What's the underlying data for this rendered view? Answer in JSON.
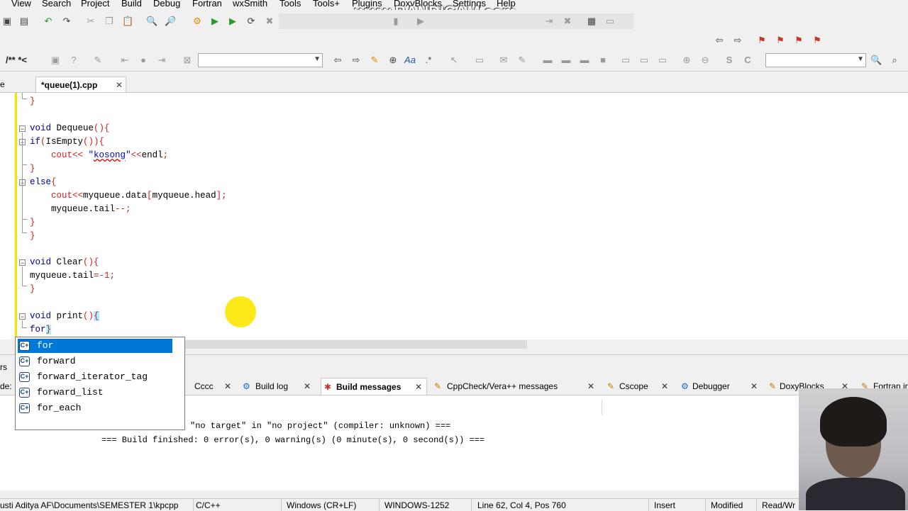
{
  "watermark": "www.BANDICAM.com",
  "menu": [
    "View",
    "Search",
    "Project",
    "Build",
    "Debug",
    "Fortran",
    "wxSmith",
    "Tools",
    "Tools+",
    "Plugins",
    "DoxyBlocks",
    "Settings",
    "Help"
  ],
  "toolbar2": {
    "doc_comment_label": "/** *<"
  },
  "editor_tabs": {
    "left_partial": "e",
    "active": "*queue(1).cpp"
  },
  "code": [
    "}",
    "",
    "void Dequeue(){",
    "if(IsEmpty()){",
    "    cout<< \"kosong\"<<endl;",
    "}",
    "else{",
    "    cout<<myqueue.data[myqueue.head];",
    "    myqueue.tail--;",
    "}",
    "}",
    "",
    "void Clear(){",
    "myqueue.tail=-1;",
    "}",
    "",
    "void print(){",
    "for}"
  ],
  "autocomplete": {
    "items": [
      "for",
      "forward",
      "forward_iterator_tag",
      "forward_list",
      "for_each"
    ],
    "selected_index": 0,
    "icon_label": "C+"
  },
  "left_panel": {
    "label1": "rs",
    "label2": "de:"
  },
  "log_tabs": [
    {
      "label": "Cccc"
    },
    {
      "label": "Build log"
    },
    {
      "label": "Build messages"
    },
    {
      "label": "CppCheck/Vera++ messages"
    },
    {
      "label": "Cscope"
    },
    {
      "label": "Debugger"
    },
    {
      "label": "DoxyBlocks"
    },
    {
      "label": "Fortran in"
    }
  ],
  "active_log_tab": "Build messages",
  "log_lines": [
    "\"no target\" in \"no project\" (compiler: unknown) ===",
    "=== Build finished: 0 error(s), 0 warning(s) (0 minute(s), 0 second(s)) ==="
  ],
  "status": {
    "path": "usti Aditya AF\\Documents\\SEMESTER 1\\kpcpp",
    "language": "C/C++",
    "line_endings": "Windows (CR+LF)",
    "encoding": "WINDOWS-1252",
    "position": "Line 62, Col 4, Pos 760",
    "mode": "Insert",
    "modified": "Modified",
    "access": "Read/Wr"
  },
  "colors": {
    "accent_selection": "#0078d7",
    "keyword": "#00008b",
    "brace": "#cc2222",
    "change_bar": "#f5e400"
  }
}
